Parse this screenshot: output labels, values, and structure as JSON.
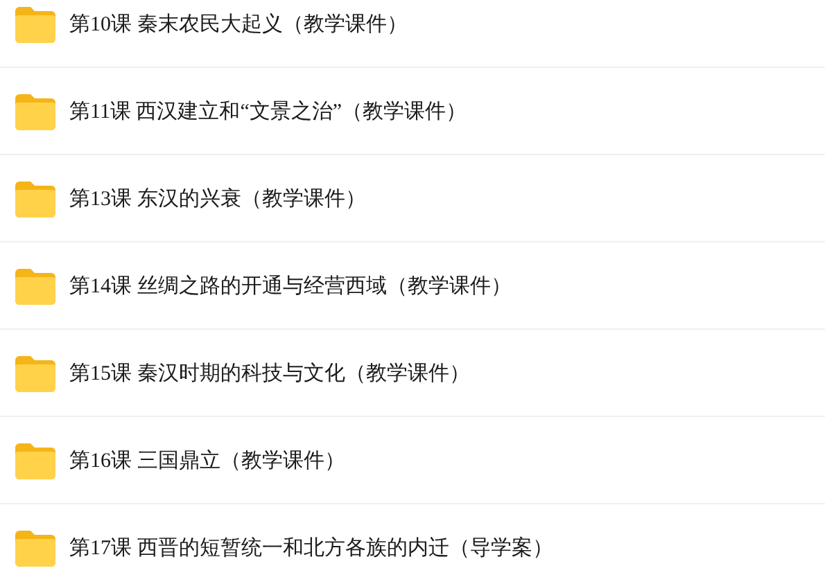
{
  "files": [
    {
      "name": "第10课 秦末农民大起义（教学课件）"
    },
    {
      "name": "第11课 西汉建立和“文景之治”（教学课件）"
    },
    {
      "name": "第13课 东汉的兴衰（教学课件）"
    },
    {
      "name": "第14课 丝绸之路的开通与经营西域（教学课件）"
    },
    {
      "name": "第15课 秦汉时期的科技与文化（教学课件）"
    },
    {
      "name": "第16课 三国鼎立（教学课件）"
    },
    {
      "name": "第17课 西晋的短暂统一和北方各族的内迁（导学案）"
    }
  ]
}
